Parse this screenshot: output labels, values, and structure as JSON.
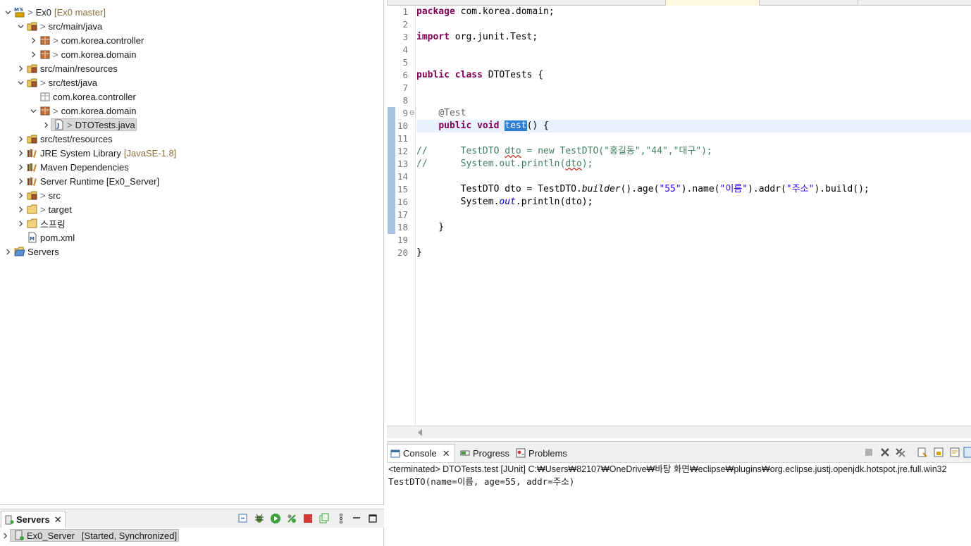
{
  "explorer": {
    "rows": [
      {
        "indent": 0,
        "chev": "down",
        "icon": "maven-project-icon",
        "prefix": "> ",
        "label": "Ex0",
        "deco": "[Ex0 master]"
      },
      {
        "indent": 1,
        "chev": "down",
        "icon": "source-folder-icon",
        "prefix": "> ",
        "label": "src/main/java",
        "deco": ""
      },
      {
        "indent": 2,
        "chev": "right",
        "icon": "package-icon",
        "prefix": "> ",
        "label": "com.korea.controller",
        "deco": ""
      },
      {
        "indent": 2,
        "chev": "right",
        "icon": "package-icon",
        "prefix": "> ",
        "label": "com.korea.domain",
        "deco": ""
      },
      {
        "indent": 1,
        "chev": "right",
        "icon": "source-folder-icon",
        "prefix": "",
        "label": "src/main/resources",
        "deco": ""
      },
      {
        "indent": 1,
        "chev": "down",
        "icon": "source-folder-icon",
        "prefix": "> ",
        "label": "src/test/java",
        "deco": ""
      },
      {
        "indent": 2,
        "chev": "none",
        "icon": "empty-package-icon",
        "prefix": "",
        "label": "com.korea.controller",
        "deco": ""
      },
      {
        "indent": 2,
        "chev": "down",
        "icon": "package-icon",
        "prefix": "> ",
        "label": "com.korea.domain",
        "deco": ""
      },
      {
        "indent": 3,
        "chev": "right",
        "icon": "java-file-icon",
        "prefix": "> ",
        "label": "DTOTests.java",
        "deco": "",
        "selected": true
      },
      {
        "indent": 1,
        "chev": "right",
        "icon": "source-folder-icon",
        "prefix": "",
        "label": "src/test/resources",
        "deco": ""
      },
      {
        "indent": 1,
        "chev": "right",
        "icon": "library-icon",
        "prefix": "",
        "label": "JRE System Library",
        "deco": "[JavaSE-1.8]"
      },
      {
        "indent": 1,
        "chev": "right",
        "icon": "library-icon",
        "prefix": "",
        "label": "Maven Dependencies",
        "deco": ""
      },
      {
        "indent": 1,
        "chev": "right",
        "icon": "library-icon",
        "prefix": "",
        "label": "Server Runtime [Ex0_Server]",
        "deco": ""
      },
      {
        "indent": 1,
        "chev": "right",
        "icon": "source-folder-icon",
        "prefix": "> ",
        "label": "src",
        "deco": ""
      },
      {
        "indent": 1,
        "chev": "right",
        "icon": "folder-icon",
        "prefix": "> ",
        "label": "target",
        "deco": ""
      },
      {
        "indent": 1,
        "chev": "right",
        "icon": "folder-icon",
        "prefix": "",
        "label": "스프링",
        "deco": ""
      },
      {
        "indent": 1,
        "chev": "none",
        "icon": "xml-file-icon",
        "prefix": "",
        "label": "pom.xml",
        "deco": ""
      },
      {
        "indent": 0,
        "chev": "right",
        "icon": "folder-open-icon",
        "prefix": "",
        "label": "Servers",
        "deco": ""
      }
    ]
  },
  "editor": {
    "current_line": 10,
    "lines": [
      {
        "n": "1",
        "html": "<span class=\"kw\">package</span> com.korea.domain;"
      },
      {
        "n": "2",
        "html": ""
      },
      {
        "n": "3",
        "html": "<span class=\"kw\">import</span> org.junit.Test;"
      },
      {
        "n": "4",
        "html": ""
      },
      {
        "n": "5",
        "html": ""
      },
      {
        "n": "6",
        "html": "<span class=\"kw\">public</span> <span class=\"kw\">class</span> DTOTests {"
      },
      {
        "n": "7",
        "html": ""
      },
      {
        "n": "8",
        "html": ""
      },
      {
        "n": "9",
        "html": "    <span class=\"ann\">@Test</span>",
        "fold": "⊖"
      },
      {
        "n": "10",
        "html": "    <span class=\"kw\">public</span> <span class=\"kw\">void</span> <span class=\"hl\">test</span>() {"
      },
      {
        "n": "11",
        "html": ""
      },
      {
        "n": "12",
        "html": "<span class=\"cmt\">//      TestDTO <span class=\"squig\">dto</span> = new TestDTO(\"홍길동\",\"44\",\"대구\");</span>"
      },
      {
        "n": "13",
        "html": "<span class=\"cmt\">//      System.out.println(<span class=\"squig\">dto</span>);</span>"
      },
      {
        "n": "14",
        "html": ""
      },
      {
        "n": "15",
        "html": "        TestDTO dto = TestDTO.<span class=\"ital\">builder</span>().age(<span class=\"str\">\"55\"</span>).name(<span class=\"str\">\"이름\"</span>).addr(<span class=\"str\">\"주소\"</span>).build();"
      },
      {
        "n": "16",
        "html": "        System.<span class=\"field\">out</span>.println(dto);"
      },
      {
        "n": "17",
        "html": ""
      },
      {
        "n": "18",
        "html": "    }"
      },
      {
        "n": "19",
        "html": ""
      },
      {
        "n": "20",
        "html": "}"
      }
    ]
  },
  "console": {
    "tabs": {
      "console": "Console",
      "progress": "Progress",
      "problems": "Problems"
    },
    "status": "<terminated> DTOTests.test [JUnit] C:₩Users₩82107₩OneDrive₩바탕 화면₩eclipse₩plugins₩org.eclipse.justj.openjdk.hotspot.jre.full.win32",
    "output": "TestDTO(name=이름, age=55, addr=주소)"
  },
  "servers": {
    "tab_label": "Servers",
    "server_name": "Ex0_Server",
    "server_state": "[Started, Synchronized]"
  },
  "colors": {
    "keyword": "#7f0055",
    "comment": "#3f7f5f",
    "string": "#2a00ff",
    "current_line": "#e8f2fe",
    "selection": "#2f7ed8"
  }
}
